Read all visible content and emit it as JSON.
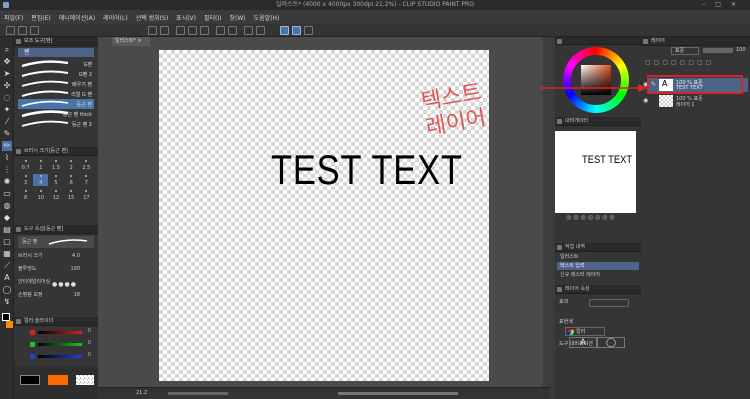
{
  "window": {
    "title": "일러스트* (4000 x 4000px 300dpi 21.2%)  - CLIP STUDIO PAINT PRO"
  },
  "menu": [
    "파일(F)",
    "편집(E)",
    "애니메이션(A)",
    "레이어(L)",
    "선택 범위(S)",
    "표시(V)",
    "필터(I)",
    "창(W)",
    "도움말(H)"
  ],
  "doc_tab": "일러스트*",
  "subtool": {
    "header": "보조 도구[펜]",
    "group": "펜",
    "brushes": [
      "G펜",
      "G펜 2",
      "배우기 펜",
      "리얼 G 펜",
      "둥근 펜",
      "둥근 펜 thick",
      "둥근 펜 2"
    ],
    "selected_index": 4
  },
  "brush_size": {
    "header": "브러시 크기[둥근 펜]",
    "sizes": [
      "0.7",
      "1",
      "1.5",
      "2",
      "2.5",
      "3",
      "4",
      "5",
      "6",
      "7",
      "8",
      "10",
      "12",
      "15",
      "17"
    ],
    "selected_index": 6
  },
  "tool_property": {
    "header": "도구 속성[둥근 펜]",
    "tab": "둥근 펜",
    "rows": [
      {
        "label": "브러시 크기",
        "value": "4.0"
      },
      {
        "label": "불투명도",
        "value": "100"
      },
      {
        "label": "안티에일리어싱",
        "value": ""
      },
      {
        "label": "손떨림 보정",
        "value": "18"
      }
    ]
  },
  "color_slider": {
    "header": "컬러 슬라이더",
    "rows": [
      {
        "channel": "R",
        "value": "0",
        "color": "#e02020"
      },
      {
        "channel": "G",
        "value": "0",
        "color": "#20c020"
      },
      {
        "channel": "B",
        "value": "0",
        "color": "#2040e0"
      }
    ]
  },
  "canvas": {
    "text": "TEST TEXT"
  },
  "annotation": {
    "line1": "텍스트",
    "line2": "레이어",
    "color": "#e0555a"
  },
  "status": {
    "zoom": "21.2"
  },
  "navigator": {
    "header": "내비게이터",
    "thumb_text": "TEST TEXT"
  },
  "task": {
    "header": "작업 내역",
    "items": [
      "일러스트",
      "텍스트 입력",
      "신규 래스터 레이어"
    ],
    "selected_index": 1
  },
  "layer_property": {
    "header": "레이어 속성",
    "effect_label": "효과",
    "color_label": "표현색",
    "color_value": "컬러",
    "text_section": "도구 내비게이션"
  },
  "layers": {
    "header": "레이어",
    "blend_mode": "표준",
    "opacity": "100",
    "items": [
      {
        "line1": "100 % 표준",
        "line2": "TEST TEXT",
        "selected": true
      },
      {
        "line1": "100 % 표준",
        "line2": "레이어 1",
        "selected": false
      }
    ]
  }
}
